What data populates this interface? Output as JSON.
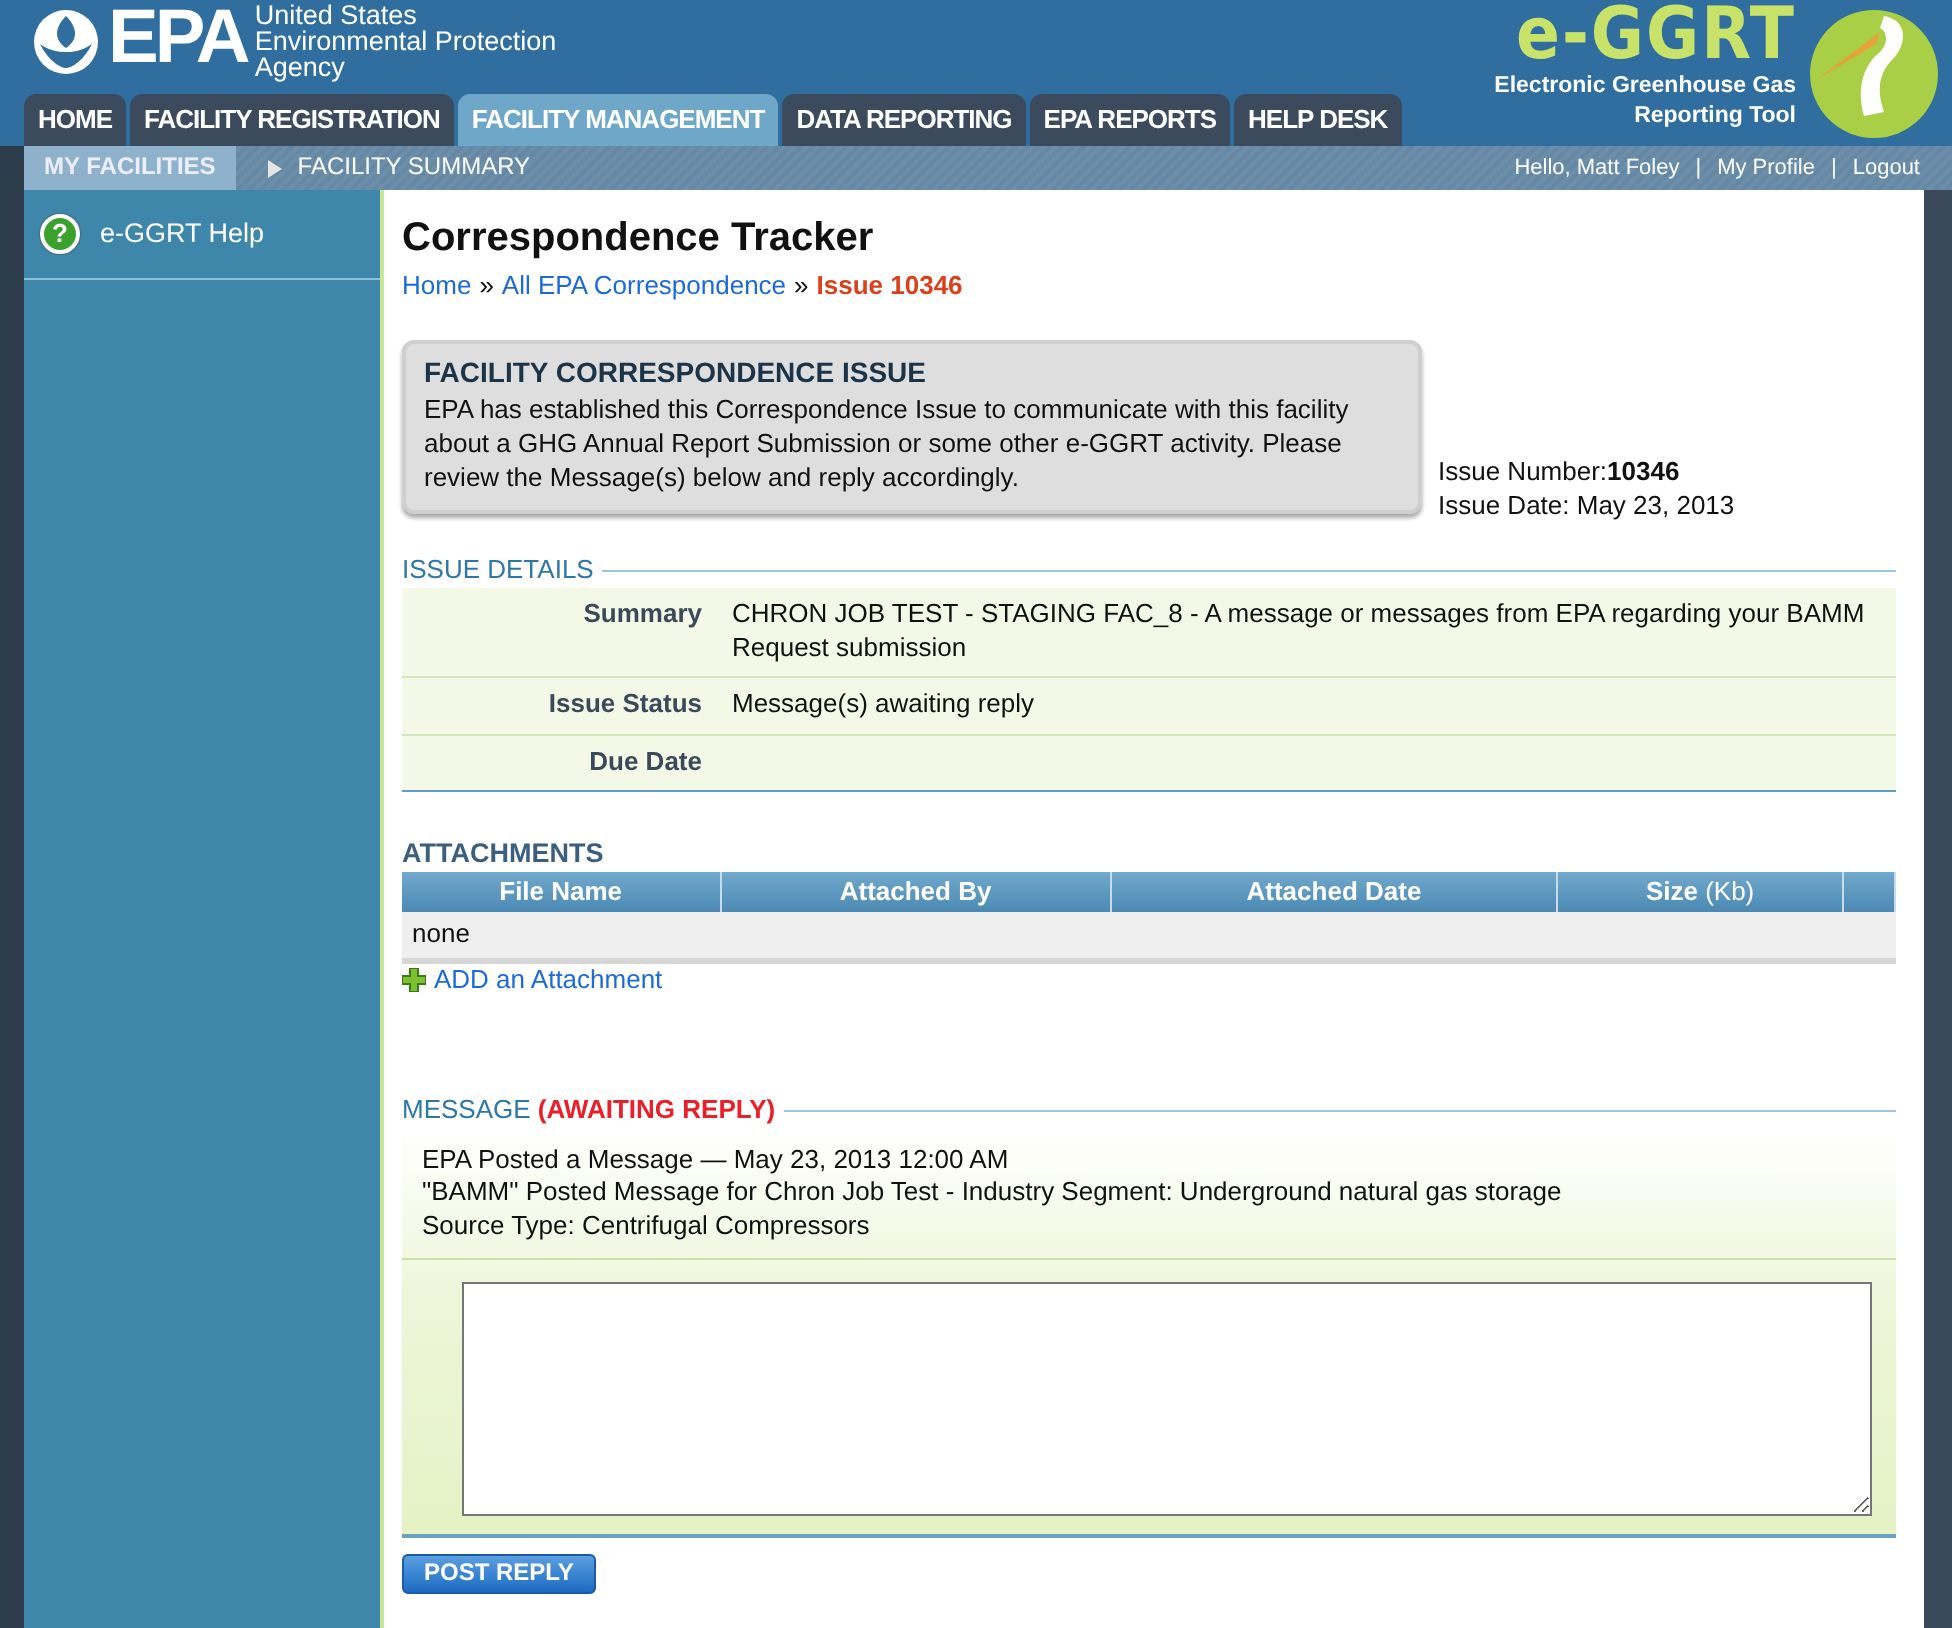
{
  "header": {
    "agency_logo": {
      "letters": "EPA",
      "lines": [
        "United States",
        "Environmental Protection",
        "Agency"
      ]
    },
    "app_logo": {
      "name": "e-GGRT",
      "lines": [
        "Electronic Greenhouse Gas",
        "Reporting Tool"
      ]
    }
  },
  "tabs": [
    {
      "label": "HOME",
      "selected": false
    },
    {
      "label": "FACILITY REGISTRATION",
      "selected": false
    },
    {
      "label": "FACILITY MANAGEMENT",
      "selected": true
    },
    {
      "label": "DATA REPORTING",
      "selected": false
    },
    {
      "label": "EPA REPORTS",
      "selected": false
    },
    {
      "label": "HELP DESK",
      "selected": false
    }
  ],
  "subnav": {
    "items": [
      {
        "label": "MY FACILITIES",
        "selected": true
      },
      {
        "label": "FACILITY SUMMARY",
        "selected": false
      }
    ],
    "greeting": "Hello, Matt Foley",
    "link_separator": "|",
    "user_links": [
      "My Profile",
      "Logout"
    ]
  },
  "sidebar": {
    "items": [
      {
        "icon": "?",
        "label": "e-GGRT Help"
      }
    ]
  },
  "page_title": "Correspondence Tracker",
  "breadcrumb": {
    "separator": "»",
    "items": [
      {
        "label": "Home",
        "current": false
      },
      {
        "label": "All EPA Correspondence",
        "current": false
      },
      {
        "label": "Issue 10346",
        "current": true
      }
    ]
  },
  "notice": {
    "title": "FACILITY CORRESPONDENCE ISSUE",
    "text": "EPA has established this Correspondence Issue to communicate with this facility about a GHG Annual Report Submission or some other e-GGRT activity. Please review the Message(s) below and reply accordingly."
  },
  "issue_info": {
    "number_label": "Issue Number:",
    "number": "10346",
    "date": "Issue Date: May 23, 2013"
  },
  "issue_details": {
    "heading": "ISSUE DETAILS",
    "rows": [
      {
        "label": "Summary",
        "value": "CHRON JOB TEST - STAGING FAC_8 - A message or messages from EPA regarding your BAMM Request submission"
      },
      {
        "label": "Issue Status",
        "value": "Message(s) awaiting reply"
      },
      {
        "label": "Due Date"
      }
    ]
  },
  "attachments": {
    "heading": "ATTACHMENTS",
    "table": {
      "columns": [
        "File Name",
        "Attached By",
        "Attached Date",
        "Size **(Kb)**"
      ],
      "rows": [
        [
          "none"
        ]
      ]
    },
    "add_link": "ADD an Attachment"
  },
  "message": {
    "heading": "MESSAGE",
    "status": "(AWAITING REPLY)",
    "lines": [
      "EPA Posted a Message — May 23, 2013 12:00 AM",
      "\"BAMM\" Posted Message for Chron Job Test - Industry Segment: Underground natural gas storage",
      "Source Type: Centrifugal Compressors"
    ],
    "post_button": "POST REPLY"
  }
}
